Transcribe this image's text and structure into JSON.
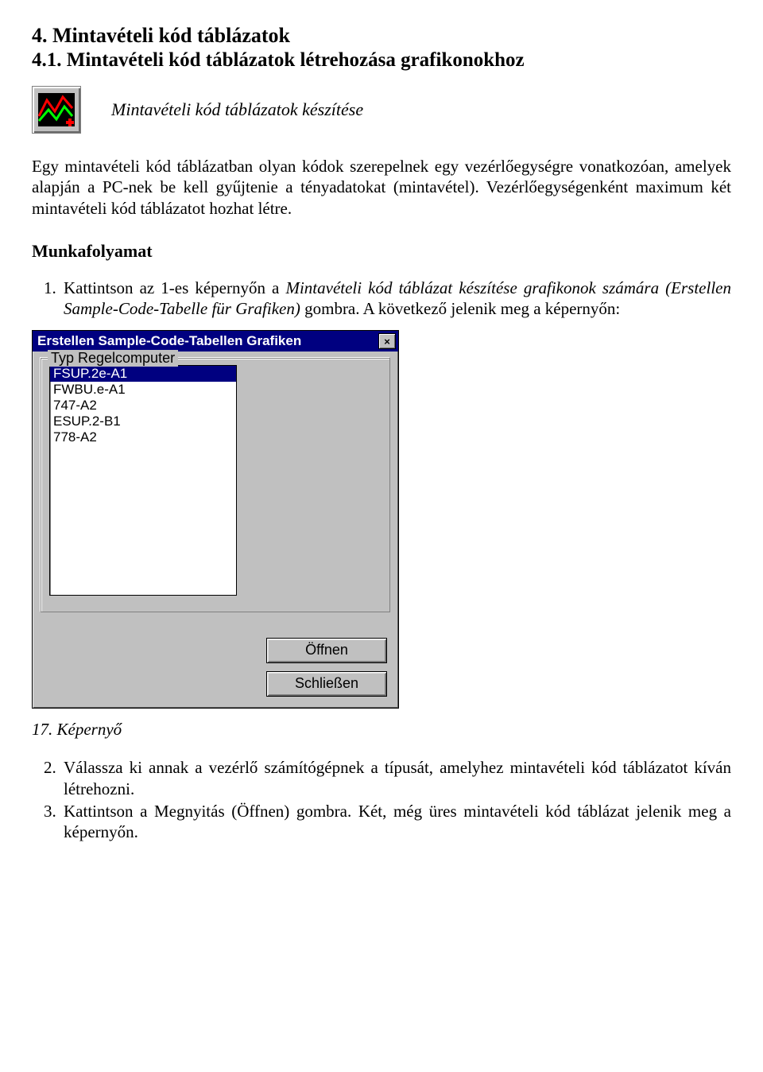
{
  "heading": "4.  Mintavételi kód táblázatok",
  "subheading": "4.1. Mintavételi kód táblázatok létrehozása grafikonokhoz",
  "iconTitle": "Mintavételi kód táblázatok készítése",
  "para1": "Egy mintavételi kód táblázatban olyan kódok szerepelnek egy vezérlőegységre vonatkozóan, amelyek alapján a PC-nek be kell gyűjtenie a tényadatokat (mintavétel). Vezérlőegységenként maximum két mintavételi kód táblázatot hozhat létre.",
  "workflowHeading": "Munkafolyamat",
  "step1_a": "Kattintson az 1-es képernyőn a ",
  "step1_b": "Mintavételi kód táblázat készítése grafikonok számára (Erstellen Sample-Code-Tabelle für Grafiken)",
  "step1_c": " gombra. A következő jelenik meg a képernyőn:",
  "dialog": {
    "title": "Erstellen Sample-Code-Tabellen Grafiken",
    "groupLabel": "Typ Regelcomputer",
    "items": [
      "FSUP.2e-A1",
      "FWBU.e-A1",
      "747-A2",
      "ESUP.2-B1",
      "778-A2"
    ],
    "selectedIndex": 0,
    "openLabel": "Öffnen",
    "closeLabel": "Schließen"
  },
  "caption": "17. Képernyő",
  "step2": "Válassza ki annak a vezérlő számítógépnek a típusát, amelyhez mintavételi kód táblázatot kíván létrehozni.",
  "step3_a": "Kattintson a ",
  "step3_b": "Megnyitás (Öffnen)",
  "step3_c": " gombra. Két, még üres mintavételi kód táblázat jelenik meg a képernyőn."
}
